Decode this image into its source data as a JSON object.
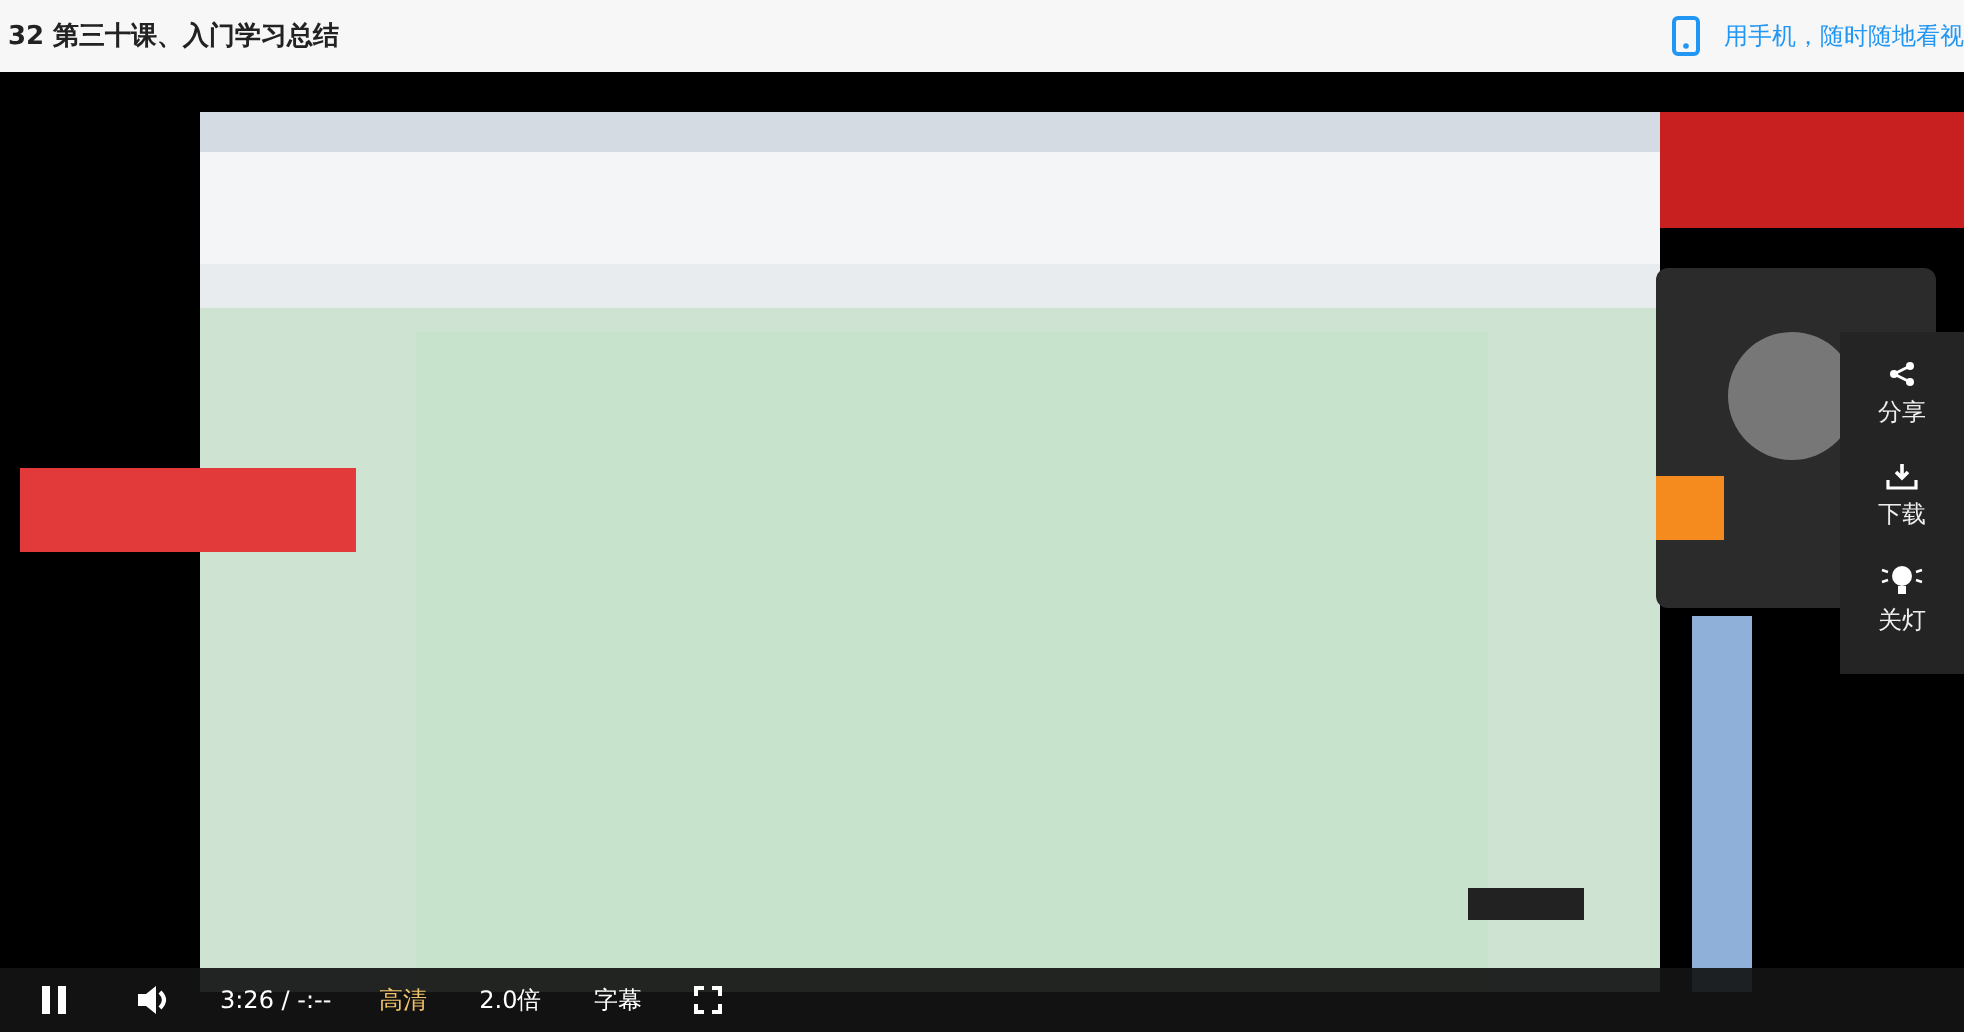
{
  "header": {
    "title": "32 第三十课、入门学习总结",
    "mobile_link": "用手机，随时随地看视"
  },
  "side_actions": [
    {
      "kind": "share",
      "label": "分享"
    },
    {
      "kind": "download",
      "label": "下载"
    },
    {
      "kind": "light",
      "label": "关灯"
    }
  ],
  "controls": {
    "playing": true,
    "time": "3:26 / -:--",
    "quality": "高清",
    "speed": "2.0倍",
    "subtitles": "字幕"
  }
}
